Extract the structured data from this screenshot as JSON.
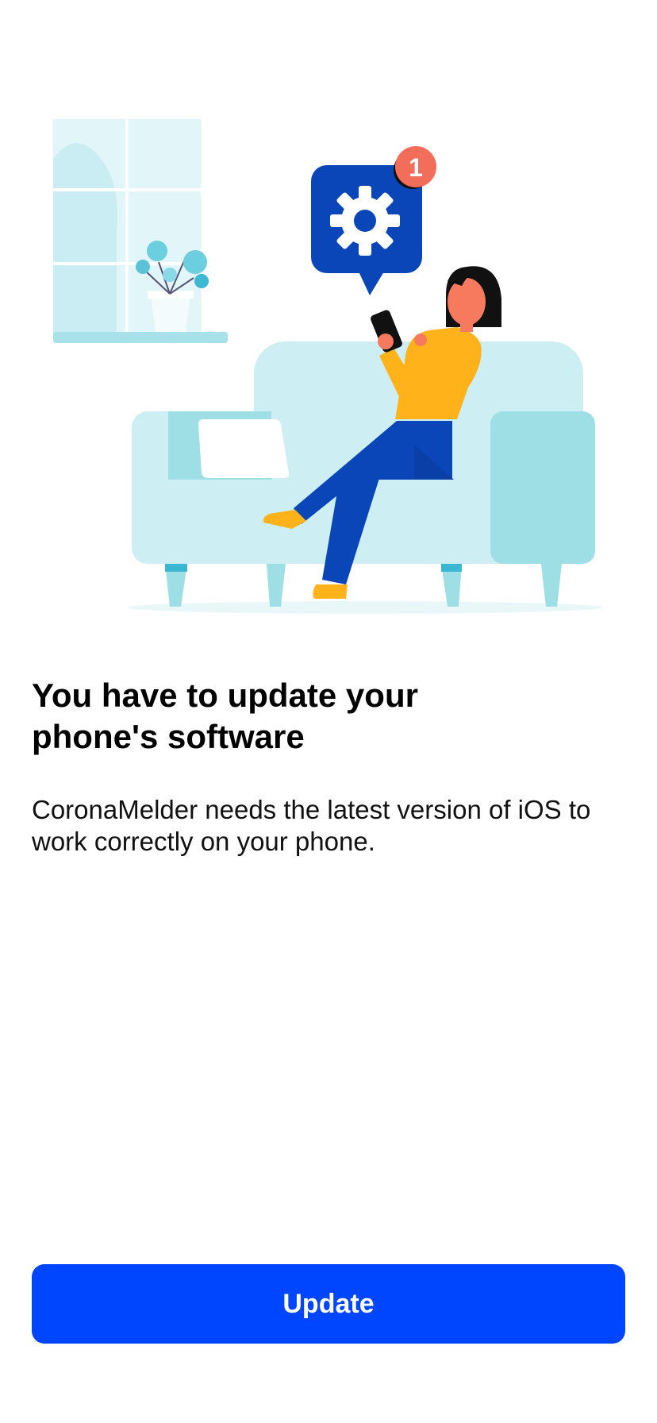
{
  "illustration": {
    "notification_count": "1",
    "icons": [
      "gear-icon",
      "notification-badge"
    ],
    "colors": {
      "accent_blue": "#0045FF",
      "dark_blue": "#0A46B8",
      "sofa": "#CDEFF3",
      "sofa_shadow": "#9EDFE6",
      "sweater": "#FFB21A",
      "badge": "#F36D5B"
    }
  },
  "content": {
    "title": "You have to update your phone's software",
    "body": "CoronaMelder needs the latest version of iOS to work correctly on your phone."
  },
  "actions": {
    "update_label": "Update"
  }
}
